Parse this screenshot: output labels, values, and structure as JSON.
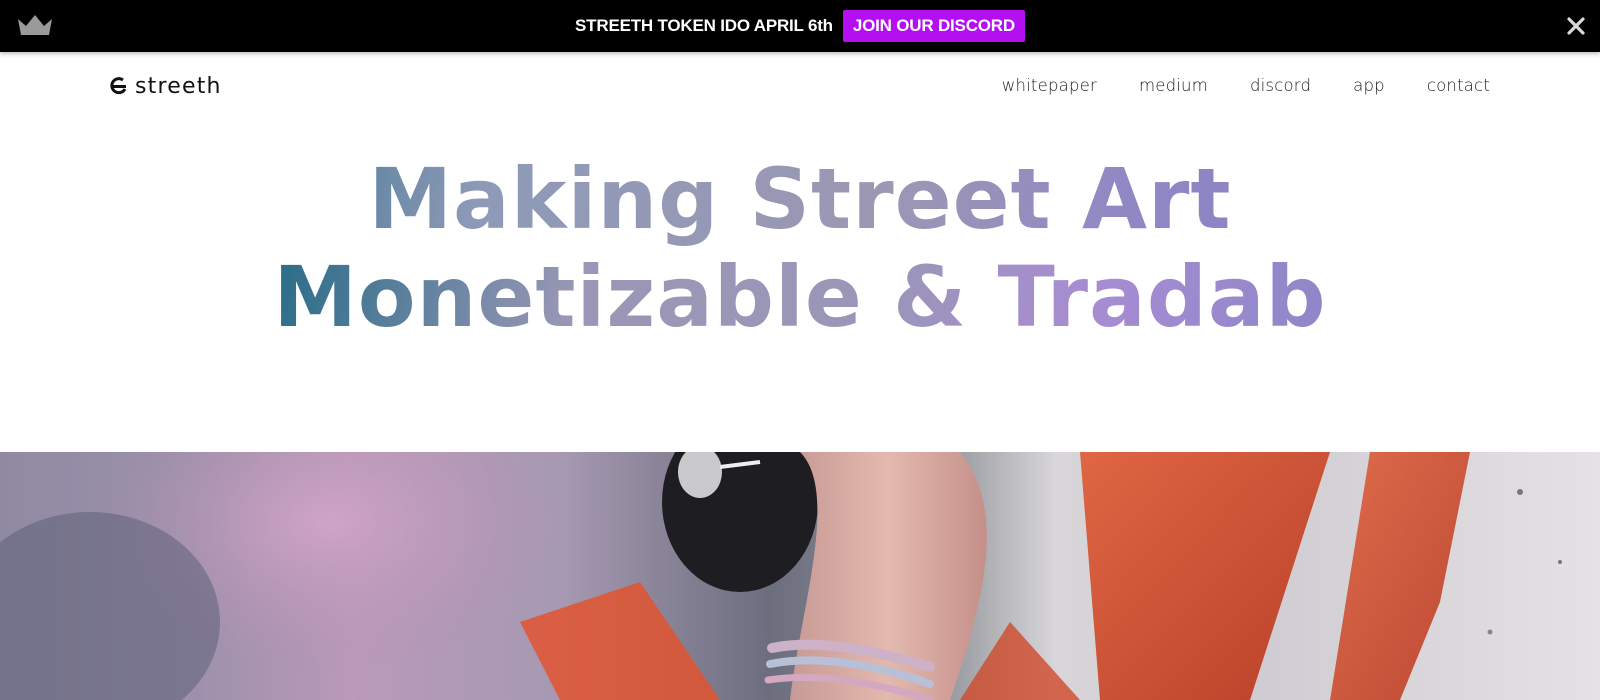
{
  "announcement": {
    "text": "STREETH TOKEN IDO APRIL 6th",
    "button_label": "JOIN OUR DISCORD",
    "left_icon": "crown-icon",
    "close_icon": "close-icon",
    "colors": {
      "bar": "#000000",
      "button": "#b40ff0"
    }
  },
  "header": {
    "logo_text": "streeth",
    "nav": [
      "whitepaper",
      "medium",
      "discord",
      "app",
      "contact"
    ]
  },
  "hero": {
    "line1": "Making Street Art",
    "line2": "Monetizable & Tradab"
  },
  "hero_image": {
    "icon": "graffiti-hand-spraycan-image"
  }
}
